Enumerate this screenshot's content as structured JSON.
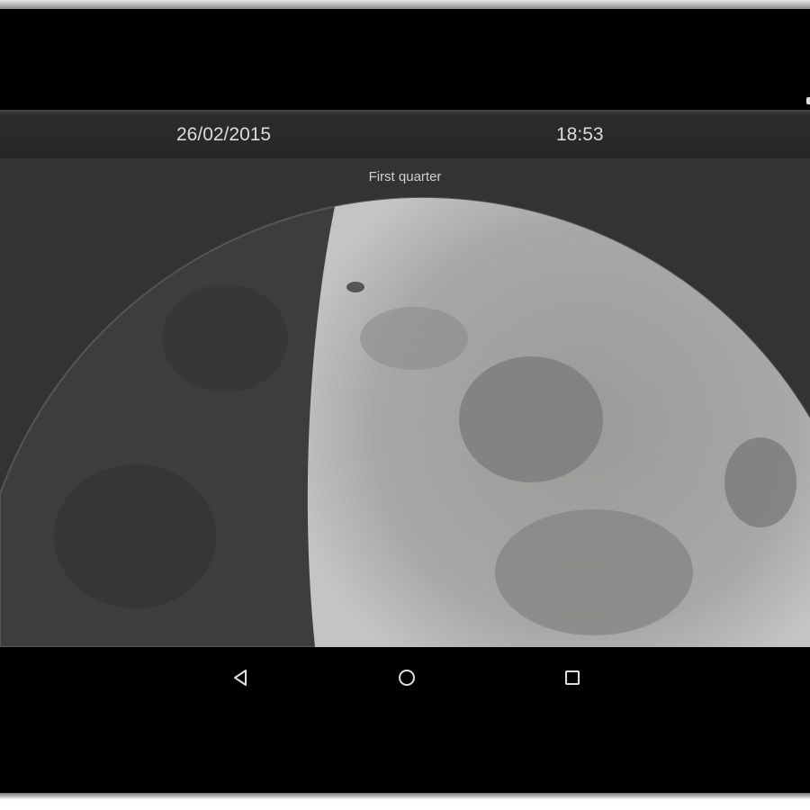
{
  "header": {
    "date": "26/02/2015",
    "time": "18:53"
  },
  "moon": {
    "phase_label": "First quarter"
  },
  "navigation": {
    "back_icon": "back-triangle-icon",
    "home_icon": "home-circle-icon",
    "recents_icon": "recents-square-icon"
  }
}
